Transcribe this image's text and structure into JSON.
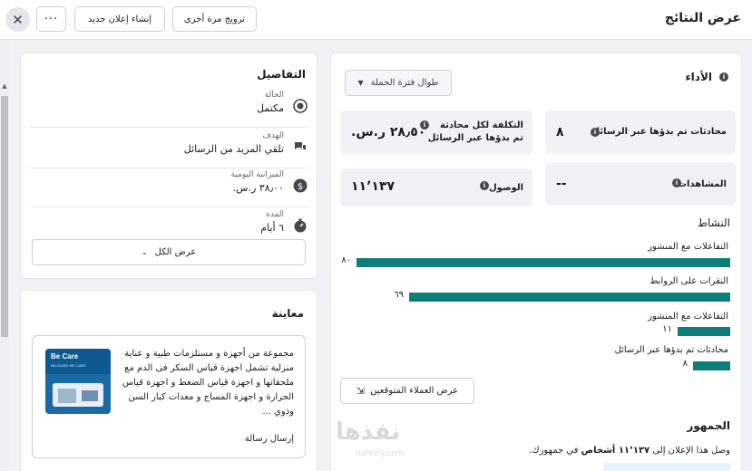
{
  "header": {
    "title": "عرض النتائج",
    "boost_again_label": "ترويج مرة أخرى",
    "create_ad_label": "إنشاء إعلان جديد",
    "more_label": "···",
    "close_label": "✕"
  },
  "performance": {
    "title": "الأداء",
    "period_dropdown": "طوال فترة الحملة",
    "metrics": [
      {
        "label": "محادثات تم بدؤها عبر الرسائل",
        "value": "٨"
      },
      {
        "label_line1": "التكلفة لكل محادثة",
        "label_line2": "تم بدؤها عبر الرسائل",
        "value": "٢٨٫٥٠ ر.س."
      },
      {
        "label": "المشاهدات",
        "value": "--"
      },
      {
        "label": "الوصول",
        "value": "١١٬١٣٧"
      }
    ],
    "activity_title": "النشاط",
    "activity": [
      {
        "label": "التفاعلات مع المنشور",
        "value": "٨٠",
        "fraction": 1.0
      },
      {
        "label": "النقرات على الروابط",
        "value": "٦٩",
        "fraction": 0.86
      },
      {
        "label": "التفاعلات مع المنشور",
        "value": "١١",
        "fraction": 0.14
      },
      {
        "label": "محادثات تم بدؤها عبر الرسائل",
        "value": "٨",
        "fraction": 0.1
      }
    ],
    "audience_button": "عرض العملاء المتوقعين",
    "audience_title": "الجمهور",
    "audience_text_prefix": "وصل هذا الإعلان إلى",
    "audience_text_bold": "١١٬١٣٧ أشخاص",
    "audience_text_suffix": "في جمهورك."
  },
  "details": {
    "title": "التفاصيل",
    "rows": [
      {
        "label": "الحالة",
        "value": "مكتمل",
        "icon": "status-icon"
      },
      {
        "label": "الهدف",
        "value": "تلقي المزيد من الرسائل",
        "icon": "messages-icon"
      },
      {
        "label": "الميزانية اليومية",
        "value": "٣٨٫٠٠ ر.س.",
        "icon": "dollar-icon"
      },
      {
        "label": "المدة",
        "value": "٦ أيام",
        "icon": "timer-icon"
      }
    ],
    "see_all_label": "عرض الكل"
  },
  "preview": {
    "title": "معاينة",
    "body": "مجموعة من أجهزة و مستلزمات طبية و عناية منزلية تشمل اجهزة قياس السكر فى الدم مع ملحقاتها و اجهزة قياس الضغط و اجهزة قياس الحرارة و اجهزة المساج و معدات كبار السن وذوي ...",
    "cta": "إرسال رسالة",
    "thumb_brand": "Be Care",
    "thumb_sub": "BECAUSE WE CARE"
  },
  "watermark": {
    "text": "نفذها",
    "sub": "nafezly.com"
  },
  "colors": {
    "bar": "#0e7e7a",
    "accent_bg": "#e7f3ff"
  }
}
